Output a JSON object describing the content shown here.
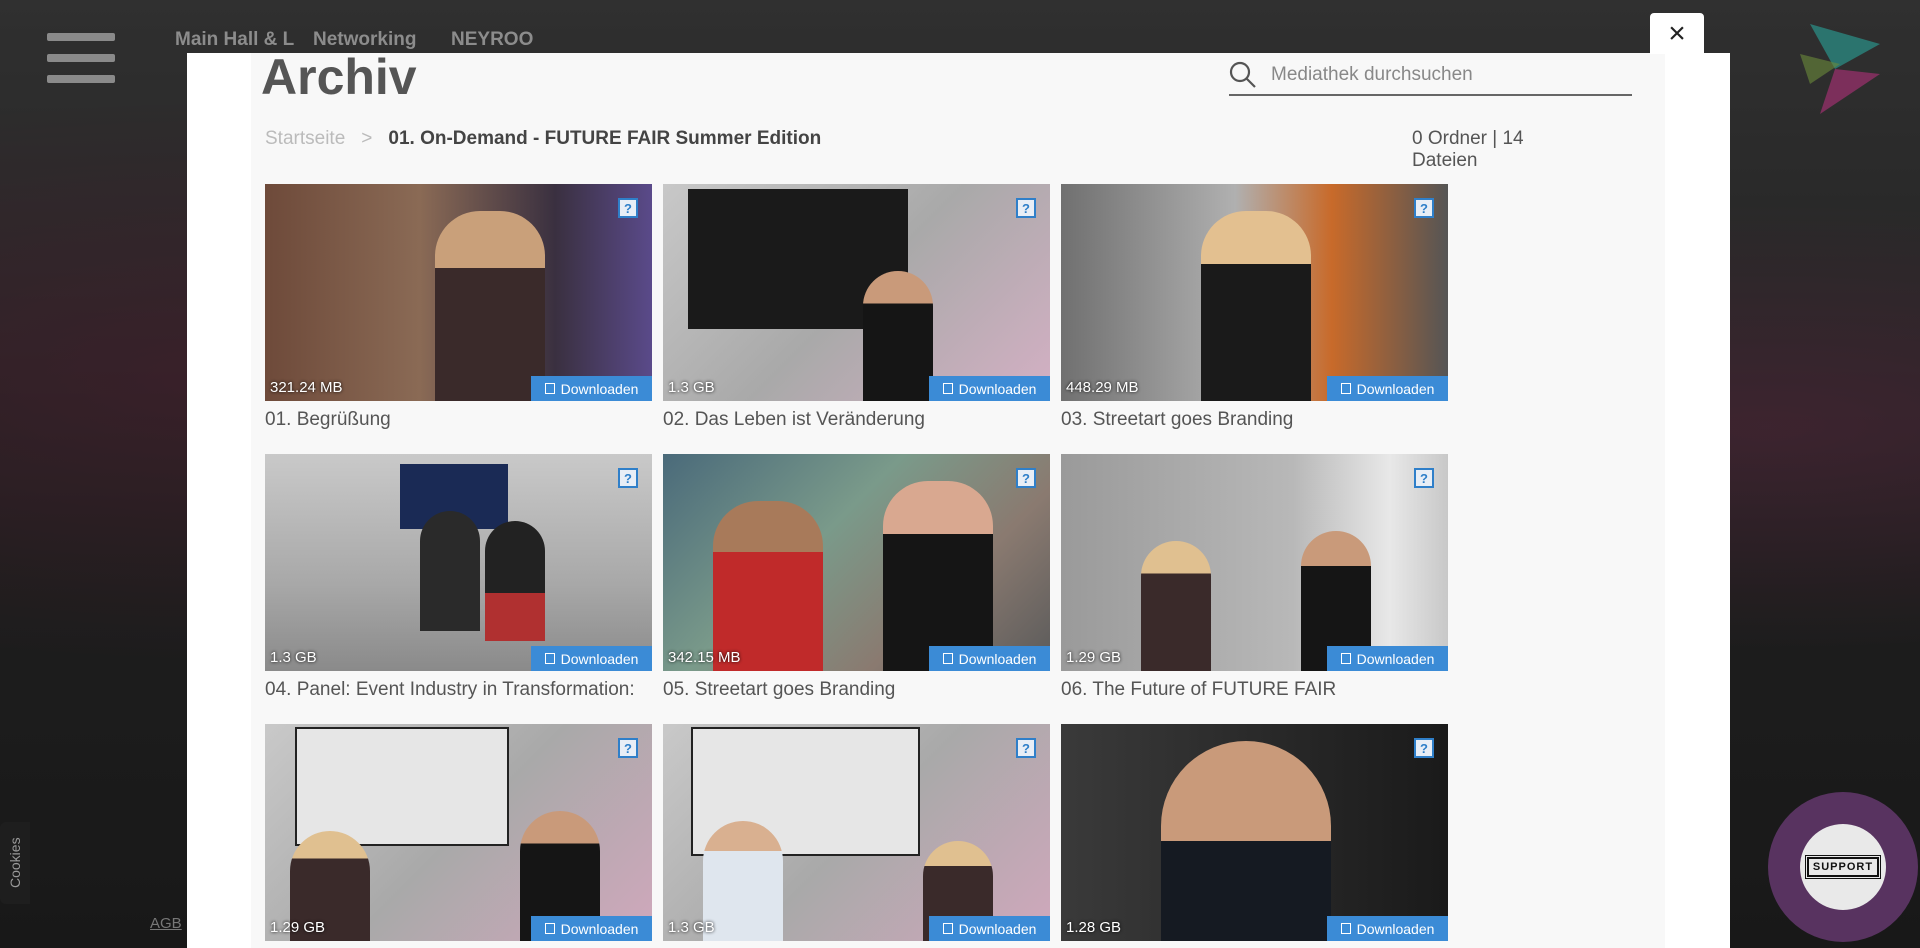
{
  "nav": {
    "items": [
      "Main Hall & L",
      "Networking",
      "NEYROO"
    ]
  },
  "modal": {
    "title": "Archiv",
    "close_icon": "×",
    "search": {
      "placeholder": "Mediathek durchsuchen"
    },
    "breadcrumb": {
      "home": "Startseite",
      "separator": ">",
      "current": "01. On-Demand - FUTURE FAIR Summer Edition"
    },
    "counts": "0 Ordner | 14 Dateien",
    "download_label": "Downloaden",
    "question_icon": "?",
    "cards": [
      {
        "title": "01. Begrüßung",
        "size": "321.24 MB"
      },
      {
        "title": "02. Das Leben ist Veränderung",
        "size": "1.3 GB"
      },
      {
        "title": "03. Streetart goes Branding",
        "size": "448.29 MB"
      },
      {
        "title": "04. Panel: Event Industry in Transformation:",
        "size": "1.3 GB"
      },
      {
        "title": "05. Streetart goes Branding",
        "size": "342.15 MB"
      },
      {
        "title": "06. The Future of FUTURE FAIR",
        "size": "1.29 GB"
      },
      {
        "title": "",
        "size": "1.29 GB"
      },
      {
        "title": "",
        "size": "1.3 GB"
      },
      {
        "title": "",
        "size": "1.28 GB"
      }
    ]
  },
  "footer": {
    "cookies": "Cookies",
    "agb": "AGB",
    "support": "SUPPORT"
  },
  "colors": {
    "accent": "#3b8bd6",
    "text": "#555555"
  }
}
